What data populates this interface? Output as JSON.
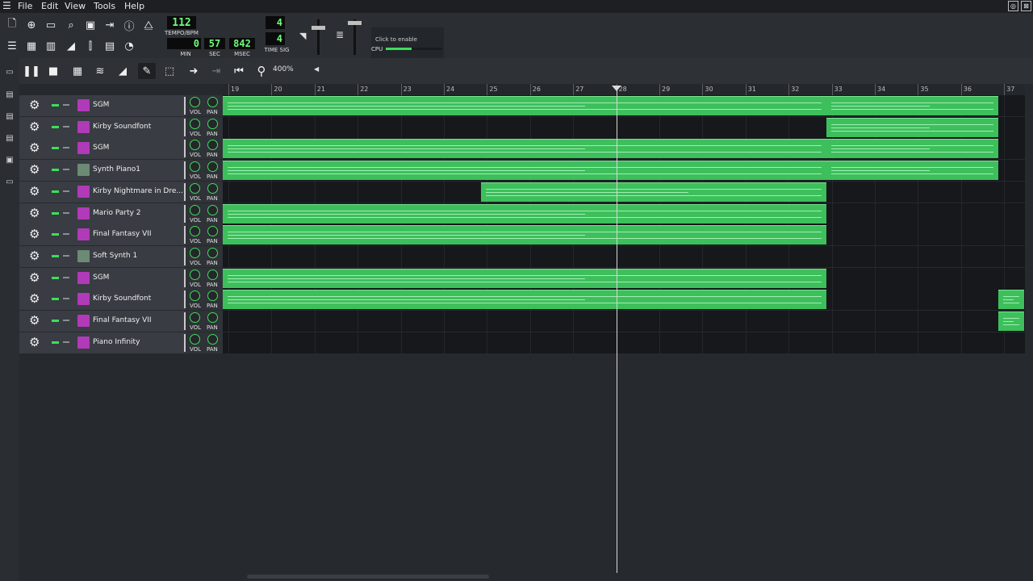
{
  "menu": [
    "File",
    "Edit",
    "View",
    "Tools",
    "Help"
  ],
  "lcd": {
    "tempo": "112",
    "tempo_label": "TEMPO/BPM",
    "min": "0",
    "min_label": "MIN",
    "sec": "57",
    "sec_label": "SEC",
    "msec": "842",
    "msec_label": "MSEC",
    "ts_num": "4",
    "ts_den": "4",
    "ts_label": "TIME SIG"
  },
  "cpu": {
    "hint": "Click to enable",
    "label": "CPU",
    "load": 0.45
  },
  "zoom": "400%",
  "ruler": [
    "19",
    "20",
    "21",
    "22",
    "23",
    "24",
    "25",
    "26",
    "27",
    "28",
    "29",
    "30",
    "31",
    "32",
    "33",
    "34",
    "35",
    "36",
    "37"
  ],
  "playhead_bar": 28,
  "knob_labels": {
    "vol": "VOL",
    "pan": "PAN"
  },
  "tracks": [
    {
      "name": "SGM",
      "icon": "soundfont-icon",
      "clips": [
        [
          19,
          33
        ],
        [
          33,
          37
        ]
      ]
    },
    {
      "name": "Kirby Soundfont",
      "icon": "soundfont-icon",
      "clips": [
        [
          33,
          37
        ]
      ]
    },
    {
      "name": "SGM",
      "icon": "soundfont-icon",
      "clips": [
        [
          19,
          33
        ],
        [
          33,
          37
        ]
      ]
    },
    {
      "name": "Synth Piano1",
      "icon": "synth-icon",
      "clips": [
        [
          19,
          33
        ],
        [
          33,
          37
        ]
      ]
    },
    {
      "name": "Kirby Nightmare in Dre...",
      "icon": "soundfont-icon",
      "clips": [
        [
          25,
          33
        ]
      ]
    },
    {
      "name": "Mario Party 2",
      "icon": "soundfont-icon",
      "clips": [
        [
          19,
          33
        ]
      ]
    },
    {
      "name": "Final Fantasy VII",
      "icon": "soundfont-icon",
      "clips": [
        [
          19,
          33
        ]
      ]
    },
    {
      "name": "Soft Synth 1",
      "icon": "synth-icon",
      "clips": []
    },
    {
      "name": "SGM",
      "icon": "soundfont-icon",
      "clips": [
        [
          19,
          33
        ]
      ]
    },
    {
      "name": "Kirby Soundfont",
      "icon": "soundfont-icon",
      "clips": [
        [
          19,
          33
        ],
        [
          37,
          37.6
        ]
      ]
    },
    {
      "name": "Final Fantasy VII",
      "icon": "soundfont-icon",
      "clips": [
        [
          37,
          37.6
        ]
      ]
    },
    {
      "name": "Piano Infinity",
      "icon": "soundfont-icon",
      "clips": []
    }
  ],
  "colors": {
    "clip": "#3dbf5c",
    "accent": "#3cde5a",
    "lcd_text": "#6dff7a"
  }
}
